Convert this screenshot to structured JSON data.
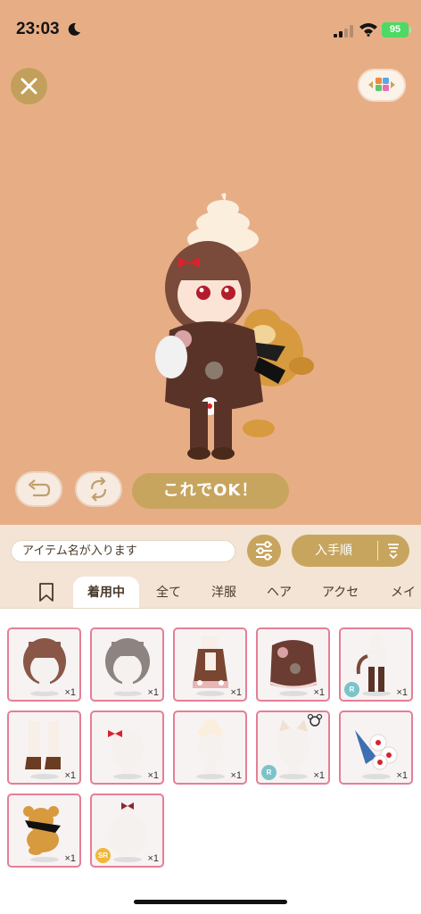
{
  "status_bar": {
    "time": "23:03",
    "battery": "95"
  },
  "stage": {
    "ok_label": "これでOK！"
  },
  "toolbar": {
    "search_placeholder": "アイテム名が入ります",
    "sort_label": "入手順"
  },
  "tabs": [
    {
      "label": "着用中",
      "active": true
    },
    {
      "label": "全て"
    },
    {
      "label": "洋服"
    },
    {
      "label": "ヘア"
    },
    {
      "label": "アクセ"
    },
    {
      "label": "メイ"
    }
  ],
  "items": [
    {
      "qty": "×1",
      "icon": "brown-bob-hair-icon"
    },
    {
      "qty": "×1",
      "icon": "gray-wavy-hair-icon"
    },
    {
      "qty": "×1",
      "icon": "brown-dress-icon"
    },
    {
      "qty": "×1",
      "icon": "brown-cape-icon"
    },
    {
      "qty": "×1",
      "icon": "cat-tail-leggings-icon",
      "rarity": "R"
    },
    {
      "qty": "×1",
      "icon": "boots-icon"
    },
    {
      "qty": "×1",
      "icon": "red-ribbon-icon"
    },
    {
      "qty": "×1",
      "icon": "soft-serve-hat-icon"
    },
    {
      "qty": "×1",
      "icon": "cat-ears-icon",
      "rarity": "R"
    },
    {
      "qty": "×1",
      "icon": "flower-bouquet-icon"
    },
    {
      "qty": "×1",
      "icon": "monkey-plush-icon"
    },
    {
      "qty": "×1",
      "icon": "ribbon-bun-icon",
      "rarity": "SR"
    }
  ]
}
